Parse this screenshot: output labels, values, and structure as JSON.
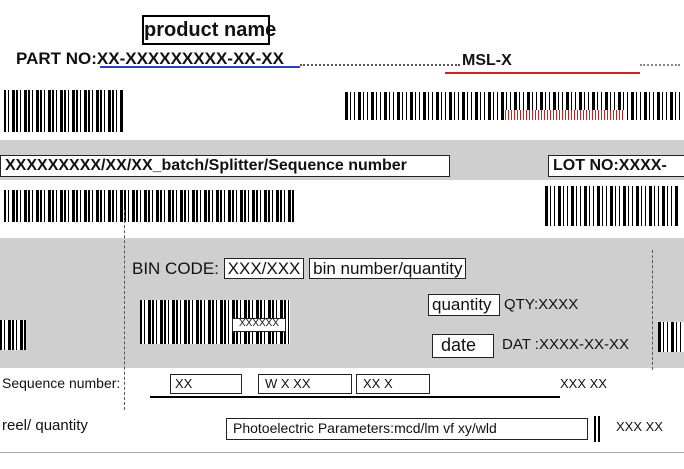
{
  "label": {
    "product_name": "product name",
    "part_no": "PART NO:XX-XXXXXXXXX-XX-XX",
    "msl": "MSL-X",
    "batch": "XXXXXXXXX/XX/XX_batch/Splitter/Sequence number",
    "lot_no": "LOT NO:XXXX-",
    "bin_code": "BIN CODE:",
    "bin_value": "XXX/XXX",
    "bin_suffix": "bin number/quantity",
    "quantity_label": "quantity",
    "quantity_value": "QTY:XXXX",
    "date_label": "date",
    "date_value": "DAT :XXXX-XX-XX",
    "sequence": "Sequence number:",
    "small_code": "XXXXXX",
    "parameters": "Photoelectric Parameters:mcd/lm vf xy/wld",
    "reel_qty": "reel/ quantity",
    "field_left": "XX",
    "field_mid1": "W X XX",
    "field_mid2": "XX X",
    "field_right": "XXX XX"
  },
  "colors": {
    "grey_panel": "#cfcfcf",
    "red_accent": "#d02020",
    "blue_accent": "#2a3fc2"
  }
}
